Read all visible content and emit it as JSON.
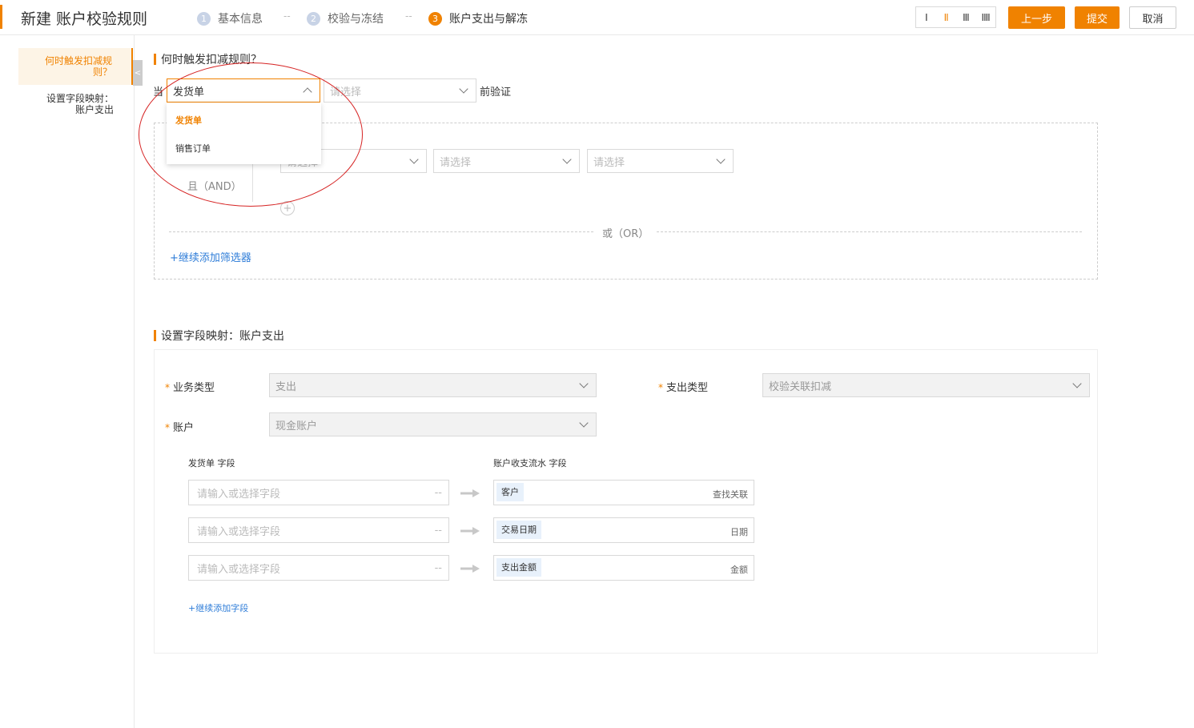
{
  "header": {
    "title": "新建 账户校验规则",
    "steps": [
      {
        "num": "1",
        "label": "基本信息"
      },
      {
        "num": "2",
        "label": "校验与冻结"
      },
      {
        "num": "3",
        "label": "账户支出与解冻"
      }
    ],
    "step_sep": "--",
    "layout_options": [
      "I",
      "II",
      "III",
      "IIII"
    ],
    "prev_label": "上一步",
    "submit_label": "提交",
    "cancel_label": "取消",
    "accent_color": "#f08200"
  },
  "leftnav": {
    "items": [
      {
        "label_l1": "何时触发扣减规",
        "label_l2": "则？"
      },
      {
        "label_l1": "设置字段映射：",
        "label_l2": "账户支出"
      }
    ],
    "collapse_icon": "<"
  },
  "trigger": {
    "title": "何时触发扣减规则？",
    "prefix": "当",
    "doc_select_value": "发货单",
    "second_select_placeholder": "请选择",
    "suffix": "前验证",
    "dropdown_options": [
      "发货单",
      "销售订单"
    ],
    "filter_placeholder_1": "请选择",
    "filter_placeholder_2": "请选择",
    "filter_placeholder_3": "请选择",
    "and_label": "且（AND）",
    "or_label": "或（OR）",
    "add_filter_label": "+继续添加筛选器"
  },
  "mapping": {
    "title": "设置字段映射：账户支出",
    "business_type_label": "业务类型",
    "business_type_value": "支出",
    "expense_type_label": "支出类型",
    "expense_type_value": "校验关联扣减",
    "account_label": "账户",
    "account_value": "现金账户",
    "source_header": "发货单 字段",
    "target_header": "账户收支流水 字段",
    "rows": [
      {
        "placeholder": "请输入或选择字段",
        "tag": "客户",
        "hint": "查找关联"
      },
      {
        "placeholder": "请输入或选择字段",
        "tag": "交易日期",
        "hint": "日期"
      },
      {
        "placeholder": "请输入或选择字段",
        "tag": "支出金额",
        "hint": "金额"
      }
    ],
    "add_field_label": "+继续添加字段"
  }
}
